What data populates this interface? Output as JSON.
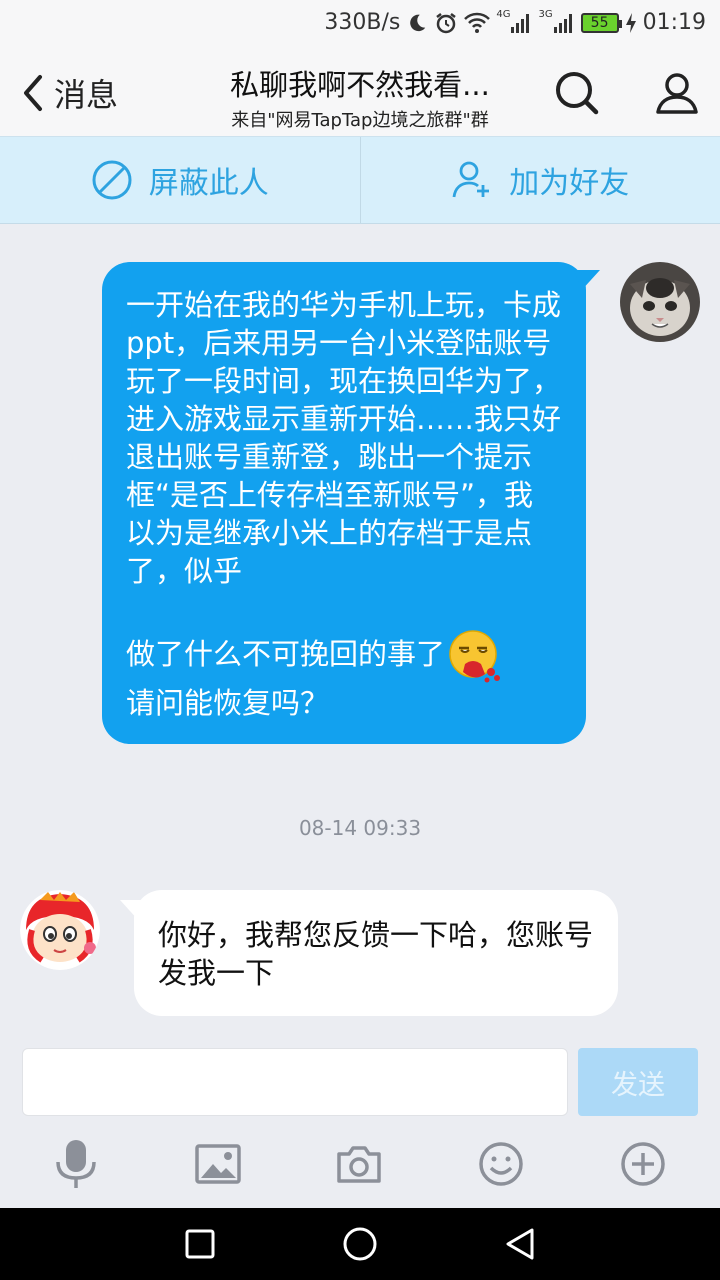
{
  "status_bar": {
    "net_speed": "330B/s",
    "net_type_1": "4G",
    "net_type_2": "3G",
    "battery": "55",
    "time": "01:19"
  },
  "header": {
    "back_label": "消息",
    "title": "私聊我啊不然我看...",
    "subtitle": "来自\"网易TapTap边境之旅群\"群"
  },
  "actions": {
    "block_label": "屏蔽此人",
    "add_friend_label": "加为好友"
  },
  "messages": [
    {
      "direction": "outgoing",
      "text": "一开始在我的华为手机上玩，卡成ppt，后来用另一台小米登陆账号玩了一段时间，现在换回华为了，进入游戏显示重新开始……我只好退出账号重新登，跳出一个提示框“是否上传存档至新账号”，我以为是继承小米上的存档于是点了，似乎\n\n做了什么不可挽回的事了",
      "text_after_emoji": "请问能恢复吗？",
      "emoji": "vomit-blood-emoji"
    },
    {
      "direction": "incoming",
      "timestamp": "08-14 09:33",
      "text": "你好，我帮您反馈一下哈，您账号发我一下"
    }
  ],
  "composer": {
    "input_value": "",
    "send_label": "发送"
  },
  "colors": {
    "accent": "#12a1ef",
    "action_bg": "#d7effb",
    "action_text": "#2ea3e0",
    "send_disabled": "#acd9f7"
  }
}
